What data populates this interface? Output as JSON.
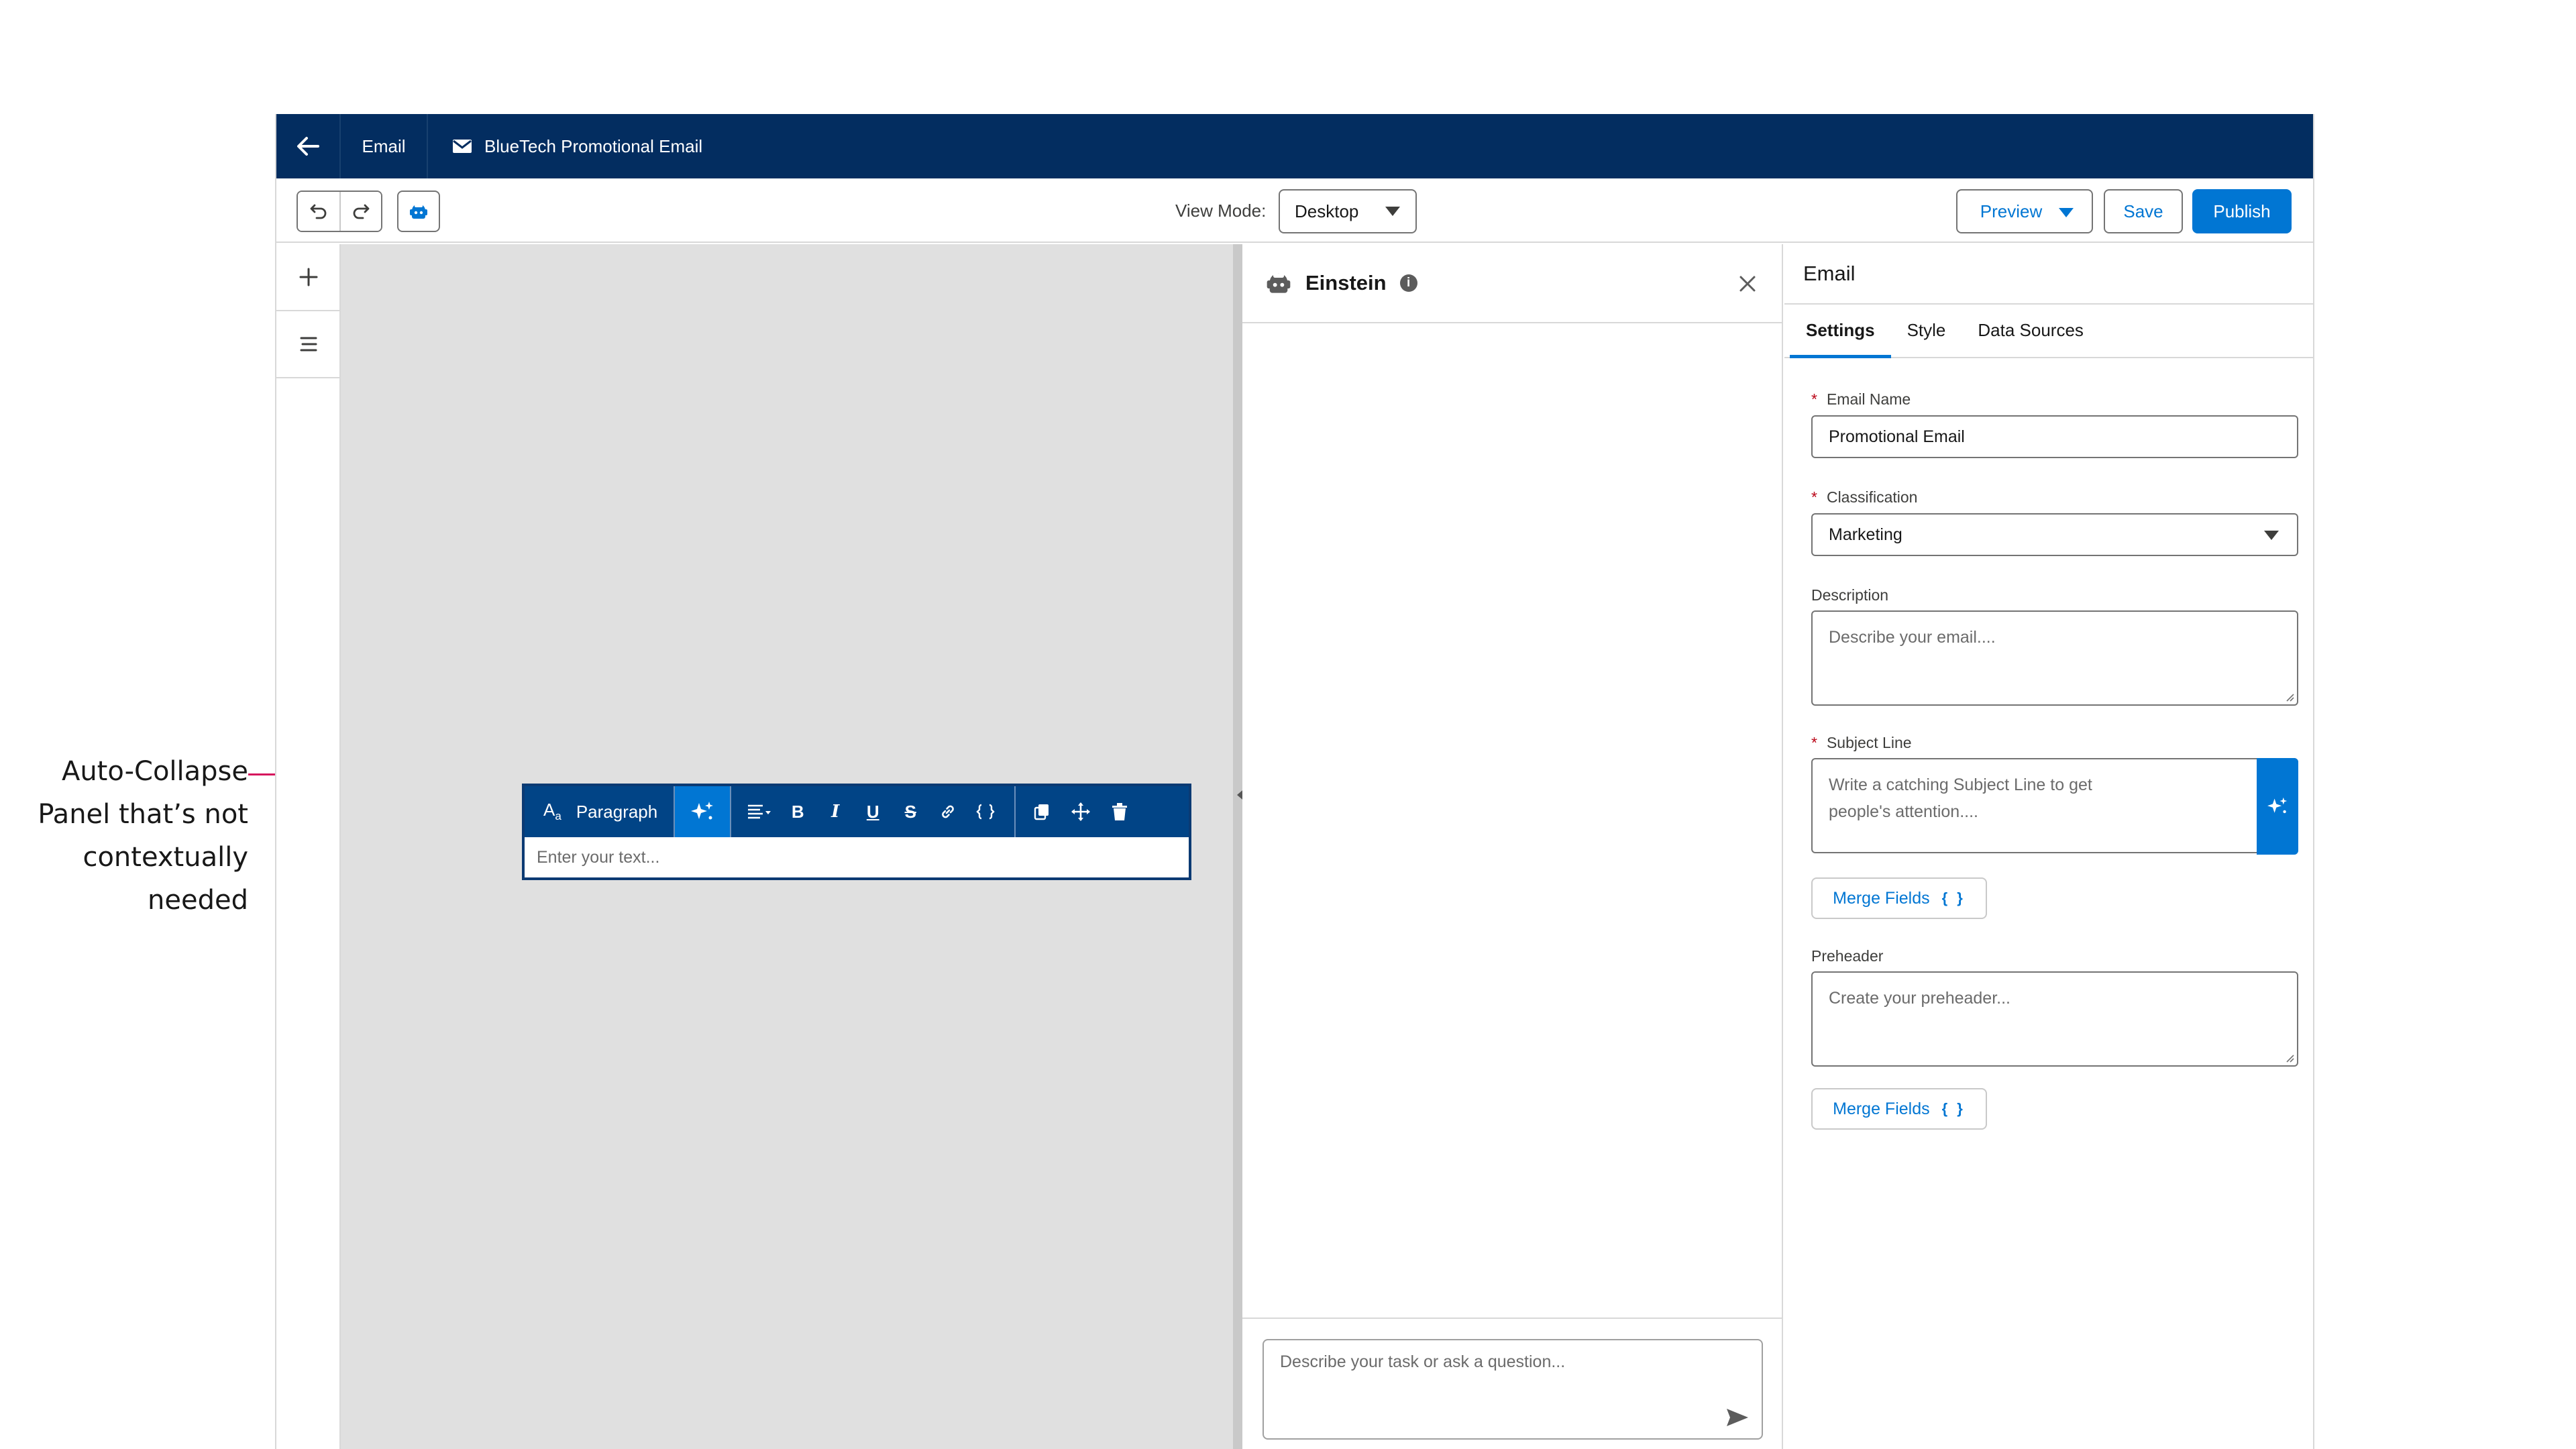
{
  "annotation": {
    "lines": [
      "Auto-Collapse",
      "Panel that’s not",
      "contextually",
      "needed"
    ]
  },
  "topbar": {
    "tab_label": "Email",
    "document_title": "BlueTech Promotional Email"
  },
  "toolbar": {
    "view_mode_label": "View Mode:",
    "view_mode_value": "Desktop",
    "preview_label": "Preview",
    "save_label": "Save",
    "publish_label": "Publish"
  },
  "editor": {
    "block_type": "Paragraph",
    "placeholder": "Enter your text..."
  },
  "einstein": {
    "title": "Einstein",
    "info_glyph": "i",
    "input_placeholder": "Describe your task or ask a question..."
  },
  "properties": {
    "title": "Email",
    "tabs": [
      {
        "label": "Settings",
        "active": true
      },
      {
        "label": "Style",
        "active": false
      },
      {
        "label": "Data Sources",
        "active": false
      }
    ],
    "required_mark": "*",
    "email_name": {
      "label": "Email Name",
      "value": "Promotional Email"
    },
    "classification": {
      "label": "Classification",
      "value": "Marketing"
    },
    "description": {
      "label": "Description",
      "placeholder": "Describe your email...."
    },
    "subject_line": {
      "label": "Subject Line",
      "placeholder_line1": "Write a catching Subject Line to get",
      "placeholder_line2": "people's attention...."
    },
    "merge_fields_label": "Merge Fields",
    "merge_fields_glyph": "{ }",
    "preheader": {
      "label": "Preheader",
      "placeholder": "Create your preheader..."
    }
  },
  "colors": {
    "brand_navy": "#032d60",
    "accent_blue": "#0176d3",
    "editor_bar": "#014486",
    "annotation_pink": "#d5135c",
    "canvas_gray": "#e0e0e0"
  }
}
